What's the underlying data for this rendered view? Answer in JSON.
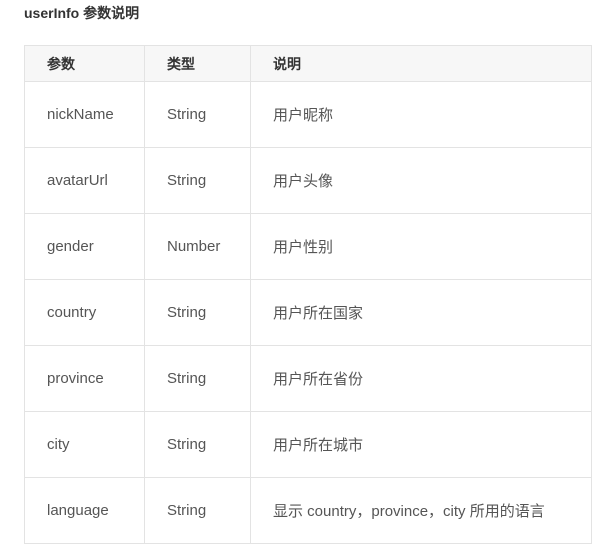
{
  "title": "userInfo 参数说明",
  "table": {
    "headers": [
      "参数",
      "类型",
      "说明"
    ],
    "rows": [
      [
        "nickName",
        "String",
        "用户昵称"
      ],
      [
        "avatarUrl",
        "String",
        "用户头像"
      ],
      [
        "gender",
        "Number",
        "用户性别"
      ],
      [
        "country",
        "String",
        "用户所在国家"
      ],
      [
        "province",
        "String",
        "用户所在省份"
      ],
      [
        "city",
        "String",
        "用户所在城市"
      ],
      [
        "language",
        "String",
        "显示 country，province，city 所用的语言"
      ]
    ]
  }
}
